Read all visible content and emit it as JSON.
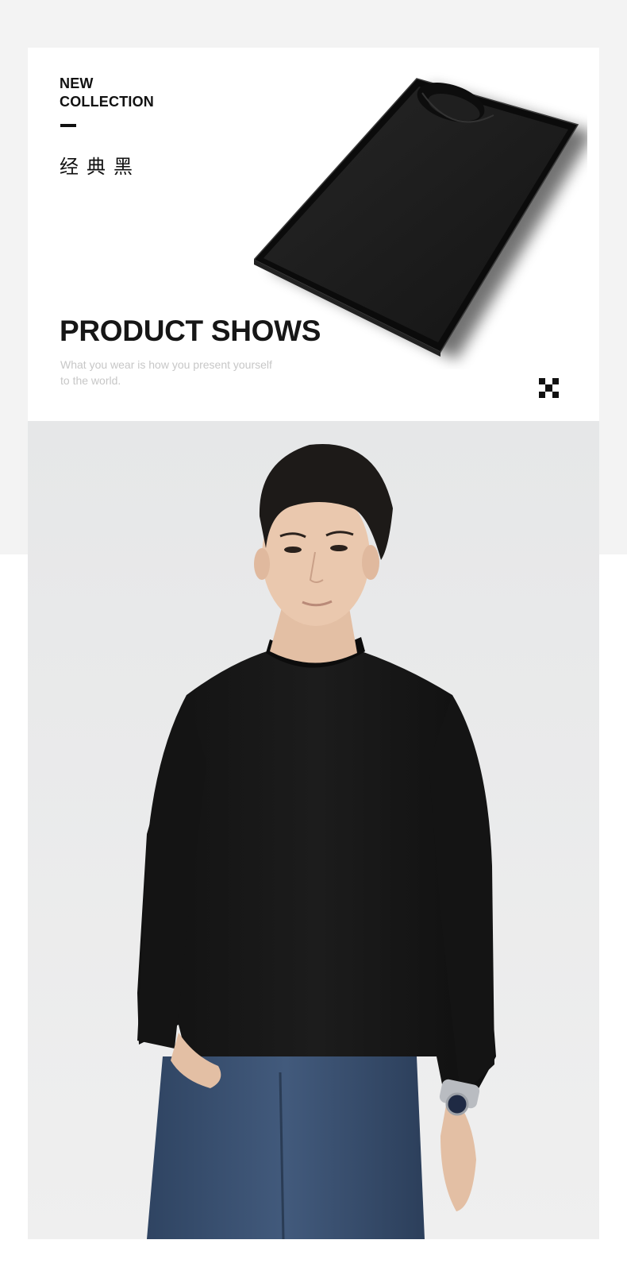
{
  "header": {
    "collection_line1": "NEW",
    "collection_line2": "COLLECTION",
    "chinese_title": "经典黑"
  },
  "showcase": {
    "title": "PRODUCT SHOWS",
    "tagline": "What you wear is  how you present yourself to the world."
  },
  "icons": {
    "corner": "checkerboard-icon",
    "product": "boxed-black-sweater-image",
    "model": "model-wearing-black-sweater-photo"
  },
  "colors": {
    "page_background": "#f3f3f3",
    "card_background": "#ffffff",
    "text_dark": "#111111",
    "text_muted": "#c7c7c7",
    "sweater": "#151515",
    "photo_background": "#e9eaeb",
    "jeans": "#3a4f6b"
  }
}
